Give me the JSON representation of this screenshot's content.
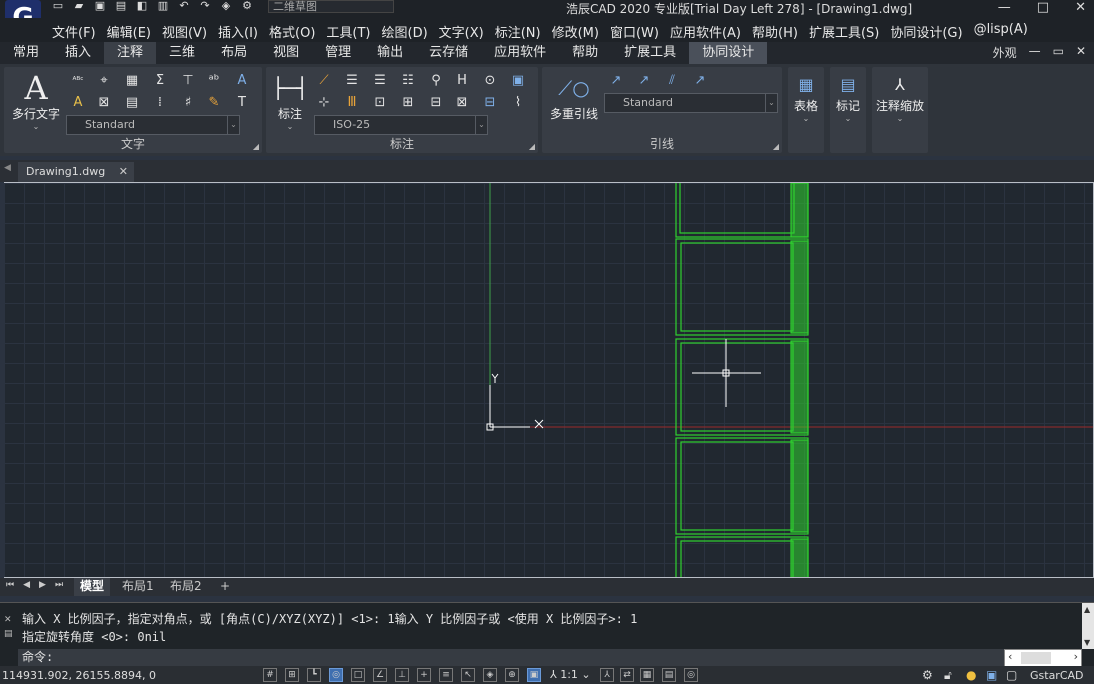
{
  "app": {
    "title": "浩辰CAD 2020 专业版[Trial Day Left 278] - [Drawing1.dwg]",
    "logo_letter": "G",
    "workspace": "二维草图",
    "window_controls": [
      "—",
      "□",
      "✕"
    ]
  },
  "menu": [
    "文件(F)",
    "编辑(E)",
    "视图(V)",
    "插入(I)",
    "格式(O)",
    "工具(T)",
    "绘图(D)",
    "文字(X)",
    "标注(N)",
    "修改(M)",
    "窗口(W)",
    "应用软件(A)",
    "帮助(H)",
    "扩展工具(S)",
    "协同设计(G)",
    "@lisp(A)"
  ],
  "ribbon_tabs": [
    "常用",
    "插入",
    "注释",
    "三维",
    "布局",
    "视图",
    "管理",
    "输出",
    "云存储",
    "应用软件",
    "帮助",
    "扩展工具",
    "协同设计"
  ],
  "ribbon_tab_active": "注释",
  "appearance_label": "外观",
  "panels": {
    "text": {
      "big_button": "多行文字",
      "style_combo": "Standard",
      "label": "文字"
    },
    "dimension": {
      "big_button": "标注",
      "style_combo": "ISO-25",
      "label": "标注"
    },
    "leader": {
      "big_button": "多重引线",
      "style_combo": "Standard",
      "label": "引线"
    },
    "table": {
      "label": "表格"
    },
    "markup": {
      "label": "标记"
    },
    "annotation_scale": {
      "label": "注释缩放"
    }
  },
  "document_tab": "Drawing1.dwg",
  "layout_tabs": [
    "模型",
    "布局1",
    "布局2",
    "+"
  ],
  "layout_tab_active": "模型",
  "command": {
    "history": [
      "输入 X 比例因子，指定对角点，或 [角点(C)/XYZ(XYZ)] <1>: 1输入 Y 比例因子或 <使用 X 比例因子>: 1",
      "指定旋转角度 <0>: 0nil"
    ],
    "prompt": "命令:"
  },
  "status": {
    "coordinates": "114931.902, 26155.8894, 0",
    "scale": "1:1",
    "product": "GstarCAD"
  },
  "colors": {
    "canvas_bg": "#212830",
    "drawing_green": "#2fd12f",
    "ucs_y_axis": "#3fa04a",
    "ucs_x_axis": "#9b2a2a"
  }
}
